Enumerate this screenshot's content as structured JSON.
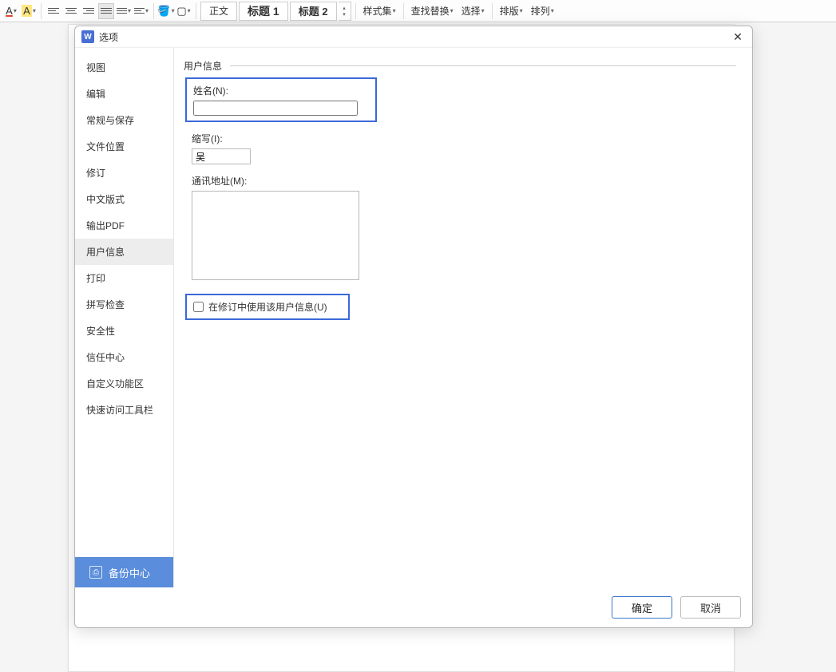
{
  "toolbar": {
    "font_color_letter": "A",
    "highlight_letter": "A",
    "styles": {
      "normal": "正文",
      "heading1": "标题 1",
      "heading2": "标题 2"
    },
    "style_set": "样式集",
    "find_replace": "查找替换",
    "select": "选择",
    "layout": "排版",
    "arrange": "排列"
  },
  "dialog": {
    "title": "选项",
    "sidebar": {
      "items": [
        "视图",
        "编辑",
        "常规与保存",
        "文件位置",
        "修订",
        "中文版式",
        "输出PDF",
        "用户信息",
        "打印",
        "拼写检查",
        "安全性",
        "信任中心",
        "自定义功能区",
        "快速访问工具栏"
      ],
      "backup": "备份中心"
    },
    "content": {
      "section_title": "用户信息",
      "name_label": "姓名(N):",
      "name_value": "",
      "initials_label": "缩写(I):",
      "initials_value": "吴",
      "address_label": "通讯地址(M):",
      "address_value": "",
      "use_in_revisions_label": "在修订中使用该用户信息(U)",
      "use_in_revisions_checked": false
    },
    "footer": {
      "ok": "确定",
      "cancel": "取消"
    }
  }
}
